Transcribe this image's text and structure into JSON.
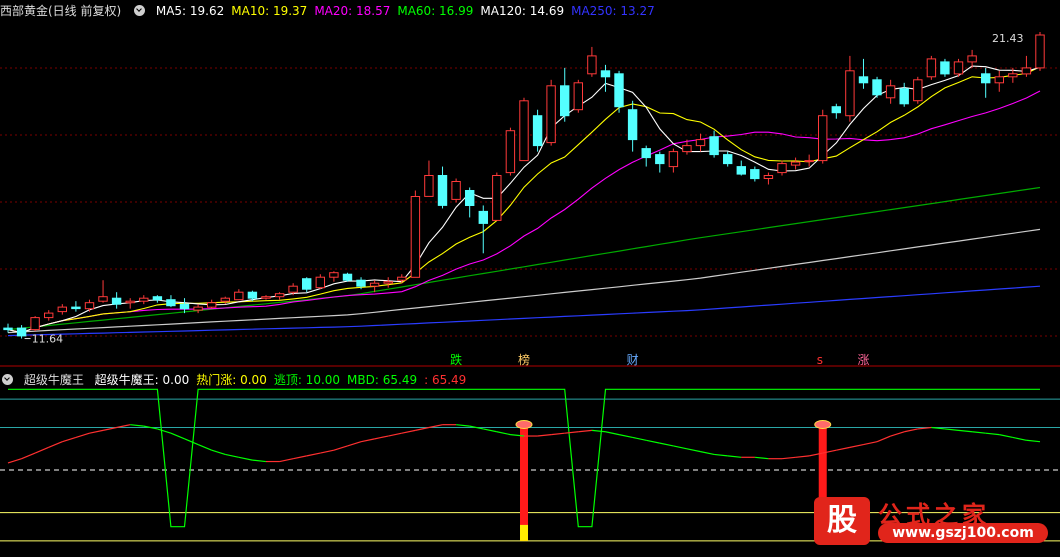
{
  "header_main": {
    "title": "西部黄金(日线 前复权)",
    "ma": [
      {
        "label": "MA5: 19.62",
        "color": "#ffffff"
      },
      {
        "label": "MA10: 19.37",
        "color": "#ffff00"
      },
      {
        "label": "MA20: 18.57",
        "color": "#ff00ff"
      },
      {
        "label": "MA60: 16.99",
        "color": "#00ff00"
      },
      {
        "label": "MA120: 14.69",
        "color": "#ffffff"
      },
      {
        "label": "MA250: 13.27",
        "color": "#3333ff"
      }
    ]
  },
  "header_indicator": {
    "title": "超级牛魔王",
    "items": [
      {
        "label": "超级牛魔王: 0.00",
        "color": "#ffffff"
      },
      {
        "label": "热门涨: 0.00",
        "color": "#ffff00"
      },
      {
        "label": "逃顶: 10.00",
        "color": "#00ff00"
      },
      {
        "label": "MBD: 65.49",
        "color": "#00ff00"
      },
      {
        "label": ": 65.49",
        "color": "#ff3030"
      }
    ]
  },
  "markers": [
    {
      "text": "跌",
      "color": "#00ff00",
      "idx": 33
    },
    {
      "text": "榜",
      "color": "#ffcc66",
      "idx": 38
    },
    {
      "text": "财",
      "color": "#66aaff",
      "idx": 46
    },
    {
      "text": "s",
      "color": "#ff3030",
      "idx": 60
    },
    {
      "text": "涨",
      "color": "#ff6699",
      "idx": 63
    }
  ],
  "watermark": {
    "title": "公式之家",
    "url": "www.gszj100.com",
    "badge": "股"
  },
  "colors": {
    "up": "#ff3a3a",
    "down": "#54ffff",
    "grid": "#7a0000"
  },
  "chart_data": [
    {
      "type": "candlestick",
      "title": "西部黄金(日线 前复权)",
      "price_labels": {
        "high": "21.43",
        "low": "11.64"
      },
      "ylim": [
        11.0,
        22.2
      ],
      "candles": [
        [
          11.9,
          12.05,
          11.75,
          11.85
        ],
        [
          11.9,
          12.0,
          11.55,
          11.64
        ],
        [
          11.85,
          12.3,
          11.8,
          12.25
        ],
        [
          12.25,
          12.5,
          12.15,
          12.4
        ],
        [
          12.45,
          12.7,
          12.35,
          12.6
        ],
        [
          12.6,
          12.8,
          12.45,
          12.55
        ],
        [
          12.55,
          12.85,
          12.45,
          12.75
        ],
        [
          12.8,
          13.5,
          12.75,
          12.95
        ],
        [
          12.9,
          13.1,
          12.55,
          12.7
        ],
        [
          12.75,
          12.9,
          12.55,
          12.8
        ],
        [
          12.8,
          13.0,
          12.7,
          12.9
        ],
        [
          12.95,
          13.0,
          12.75,
          12.85
        ],
        [
          12.85,
          13.0,
          12.6,
          12.65
        ],
        [
          12.7,
          12.9,
          12.4,
          12.55
        ],
        [
          12.5,
          12.7,
          12.4,
          12.6
        ],
        [
          12.6,
          12.85,
          12.55,
          12.75
        ],
        [
          12.8,
          12.95,
          12.7,
          12.9
        ],
        [
          12.85,
          13.2,
          12.85,
          13.1
        ],
        [
          13.1,
          13.15,
          12.8,
          12.9
        ],
        [
          12.9,
          13.0,
          12.85,
          12.95
        ],
        [
          12.95,
          13.1,
          12.85,
          13.05
        ],
        [
          13.1,
          13.4,
          13.0,
          13.3
        ],
        [
          13.55,
          13.6,
          13.1,
          13.2
        ],
        [
          13.25,
          13.7,
          13.2,
          13.6
        ],
        [
          13.6,
          13.8,
          13.45,
          13.75
        ],
        [
          13.7,
          13.75,
          13.45,
          13.5
        ],
        [
          13.5,
          13.6,
          13.2,
          13.3
        ],
        [
          13.3,
          13.5,
          13.1,
          13.4
        ],
        [
          13.4,
          13.6,
          13.25,
          13.45
        ],
        [
          13.5,
          13.7,
          13.4,
          13.6
        ],
        [
          13.6,
          16.5,
          13.6,
          16.3
        ],
        [
          16.3,
          17.5,
          16.3,
          17.0
        ],
        [
          17.0,
          17.3,
          15.9,
          16.0
        ],
        [
          16.2,
          16.9,
          16.1,
          16.8
        ],
        [
          16.5,
          16.6,
          15.6,
          16.0
        ],
        [
          15.8,
          16.0,
          14.4,
          15.4
        ],
        [
          15.5,
          17.1,
          15.5,
          17.0
        ],
        [
          17.1,
          18.6,
          17.0,
          18.5
        ],
        [
          17.5,
          19.6,
          17.5,
          19.5
        ],
        [
          19.0,
          19.2,
          17.8,
          18.0
        ],
        [
          18.1,
          20.2,
          18.0,
          20.0
        ],
        [
          20.0,
          20.6,
          18.8,
          19.0
        ],
        [
          19.2,
          20.2,
          19.1,
          20.1
        ],
        [
          20.4,
          21.3,
          20.3,
          21.0
        ],
        [
          20.5,
          20.7,
          19.8,
          20.3
        ],
        [
          20.4,
          20.5,
          19.1,
          19.3
        ],
        [
          19.2,
          19.5,
          17.8,
          18.2
        ],
        [
          17.9,
          18.0,
          17.3,
          17.6
        ],
        [
          17.7,
          17.8,
          17.1,
          17.4
        ],
        [
          17.3,
          17.9,
          17.1,
          17.8
        ],
        [
          17.8,
          18.2,
          17.7,
          18.0
        ],
        [
          18.0,
          18.4,
          17.8,
          18.2
        ],
        [
          18.3,
          18.5,
          17.6,
          17.7
        ],
        [
          17.7,
          17.8,
          17.3,
          17.4
        ],
        [
          17.3,
          17.5,
          17.0,
          17.05
        ],
        [
          17.2,
          17.3,
          16.8,
          16.9
        ],
        [
          16.9,
          17.1,
          16.7,
          17.0
        ],
        [
          17.1,
          17.5,
          17.0,
          17.4
        ],
        [
          17.35,
          17.6,
          17.2,
          17.45
        ],
        [
          17.5,
          17.7,
          17.3,
          17.5
        ],
        [
          17.5,
          19.2,
          17.4,
          19.0
        ],
        [
          19.3,
          19.4,
          18.9,
          19.1
        ],
        [
          19.0,
          21.0,
          18.8,
          20.5
        ],
        [
          20.3,
          20.9,
          19.9,
          20.1
        ],
        [
          20.2,
          20.3,
          19.6,
          19.7
        ],
        [
          19.6,
          20.2,
          19.4,
          20.0
        ],
        [
          19.9,
          20.1,
          19.3,
          19.4
        ],
        [
          19.5,
          20.3,
          19.4,
          20.2
        ],
        [
          20.3,
          21.0,
          20.2,
          20.9
        ],
        [
          20.8,
          20.9,
          20.3,
          20.4
        ],
        [
          20.4,
          20.9,
          20.3,
          20.8
        ],
        [
          20.8,
          21.2,
          20.6,
          21.0
        ],
        [
          20.4,
          20.6,
          19.6,
          20.1
        ],
        [
          20.1,
          20.5,
          19.8,
          20.3
        ],
        [
          20.3,
          20.6,
          20.1,
          20.4
        ],
        [
          20.4,
          21.0,
          20.3,
          20.6
        ],
        [
          20.6,
          21.8,
          20.5,
          21.7
        ]
      ],
      "ma_series": [
        {
          "name": "MA5",
          "period": 5,
          "color": "#ffffff"
        },
        {
          "name": "MA10",
          "period": 10,
          "color": "#ffff00"
        },
        {
          "name": "MA20",
          "period": 20,
          "color": "#ff00ff"
        },
        {
          "name": "MA60",
          "period": 60,
          "color": "#00ff00"
        },
        {
          "name": "MA120",
          "period": 120,
          "color": "#ffffff"
        },
        {
          "name": "MA250",
          "period": 250,
          "color": "#3333ff"
        }
      ],
      "long_ma_lines": [
        {
          "name": "MA60",
          "values": [
            11.85,
            13.0,
            14.9,
            16.6
          ],
          "color": "#00aa00"
        },
        {
          "name": "MA120",
          "values": [
            11.75,
            12.35,
            13.55,
            15.2
          ],
          "color": "#cccccc"
        },
        {
          "name": "MA250",
          "values": [
            11.65,
            11.95,
            12.5,
            13.3
          ],
          "color": "#2a3cff"
        }
      ]
    },
    {
      "type": "line",
      "title": "超级牛魔王",
      "ylim": [
        -5,
        110
      ],
      "levels": [
        {
          "value": 100,
          "color": "#2aa7a7",
          "style": "solid"
        },
        {
          "value": 80,
          "color": "#2aa7a7",
          "style": "solid"
        },
        {
          "value": 50,
          "color": "#ffffff",
          "style": "dashed"
        },
        {
          "value": 20,
          "color": "#ffff66",
          "style": "solid"
        },
        {
          "value": 0,
          "color": "#ffff66",
          "style": "solid"
        }
      ],
      "series": [
        {
          "name": "逃顶",
          "color": "#00ff00",
          "values": [
            110,
            110,
            110,
            110,
            110,
            110,
            110,
            110,
            110,
            110,
            110,
            110,
            10,
            10,
            110,
            110,
            110,
            110,
            110,
            110,
            110,
            110,
            110,
            110,
            110,
            110,
            110,
            110,
            110,
            110,
            110,
            110,
            110,
            110,
            110,
            110,
            110,
            110,
            110,
            110,
            110,
            110,
            10,
            10,
            110,
            110,
            110,
            110,
            110,
            110,
            110,
            110,
            110,
            110,
            110,
            110,
            110,
            110,
            110,
            110,
            110,
            110,
            110,
            110,
            110,
            110,
            110,
            110,
            110,
            110,
            110,
            110,
            110,
            110,
            110,
            110,
            110
          ]
        },
        {
          "name": "MBD",
          "colors": [
            "#ff3030",
            "#00ff00"
          ],
          "values": [
            55,
            58,
            62,
            66,
            70,
            73,
            76,
            78,
            80,
            82,
            81,
            79,
            76,
            72,
            68,
            64,
            61,
            59,
            57,
            56,
            56,
            58,
            60,
            62,
            64,
            67,
            70,
            72,
            74,
            76,
            78,
            80,
            82,
            82,
            81,
            79,
            77,
            75,
            74,
            74,
            75,
            76,
            77,
            78,
            77,
            75,
            73,
            71,
            69,
            67,
            65,
            63,
            61,
            60,
            59,
            59,
            58,
            58,
            59,
            60,
            62,
            64,
            66,
            68,
            70,
            74,
            77,
            79,
            80,
            79,
            78,
            77,
            76,
            75,
            73,
            71,
            70
          ]
        }
      ],
      "bars": [
        {
          "name": "热门涨",
          "idx": 38,
          "value": 80
        },
        {
          "name": "热门涨",
          "idx": 60,
          "value": 80
        }
      ]
    }
  ]
}
